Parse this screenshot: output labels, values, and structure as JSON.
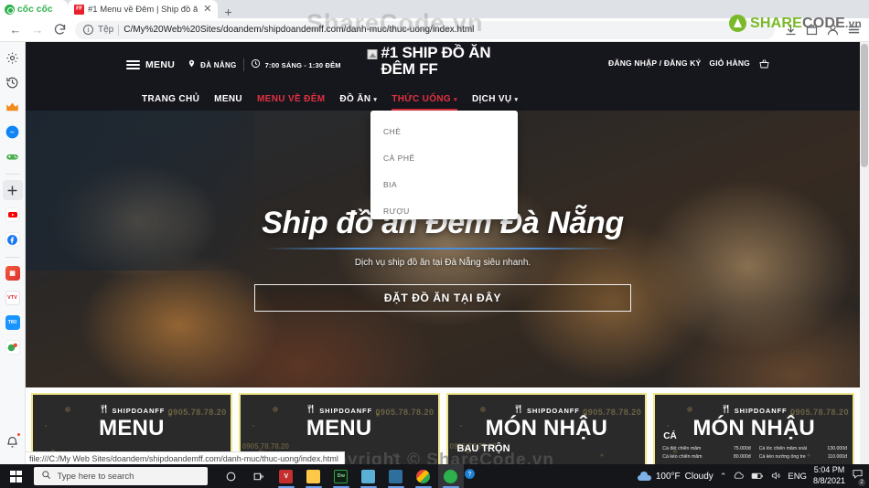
{
  "browser": {
    "brand_tab": "cốc cốc",
    "tab": {
      "title": "#1 Menu về Đêm | Ship đồ ă",
      "favicon_label": "FF",
      "close": "✕",
      "new_tab": "+"
    },
    "toolbar": {
      "back": "←",
      "forward": "→",
      "reload": "C",
      "scheme_label": "Tệp",
      "url": "C/My%20Web%20Sites/doandem/shipdoandemff.com/danh-muc/thuc-uong/index.html"
    },
    "status_url": "file:///C:/My Web Sites/doandem/shipdoandemff.com/danh-muc/thuc-uong/index.html"
  },
  "sidebar": {
    "items": [
      {
        "name": "settings-icon",
        "label": "⚙"
      },
      {
        "name": "history-icon",
        "label": "⟲"
      },
      {
        "name": "crown-icon",
        "label": "♛",
        "color": "#f28a1c"
      },
      {
        "name": "messenger-icon",
        "label": "✈",
        "color": "#1e88e5"
      },
      {
        "name": "gamepad-icon",
        "label": "🎮",
        "color": "#4caf50"
      },
      {
        "name": "add-icon",
        "label": "+"
      },
      {
        "name": "youtube-icon",
        "label": "▶",
        "color": "#ff0000"
      },
      {
        "name": "facebook-icon",
        "label": "f",
        "color": "#1877f2"
      },
      {
        "name": "app-red-icon",
        "label": "▦",
        "color": "#e8453c"
      },
      {
        "name": "vtv-icon",
        "label": "VTV",
        "color": "#ffffff"
      },
      {
        "name": "tiki-icon",
        "label": "TIKI",
        "color": "#1a94ff"
      },
      {
        "name": "green-app-icon",
        "label": "●",
        "color": "#3aa655"
      },
      {
        "name": "notifications-bell-icon",
        "label": "🔔"
      },
      {
        "name": "more-icon",
        "label": "•••"
      }
    ]
  },
  "site": {
    "menu_label": "MENU",
    "location": "ĐÀ NẴNG",
    "hours": "7:00 SÁNG - 1:30 ĐÊM",
    "brand_title": "#1 SHIP ĐỒ ĂN ĐÊM FF",
    "login_label": "ĐĂNG NHẬP / ĐĂNG KÝ",
    "cart_label": "GIỎ HÀNG",
    "nav": [
      {
        "label": "TRANG CHỦ",
        "active": false,
        "caret": false
      },
      {
        "label": "MENU",
        "active": false,
        "caret": false
      },
      {
        "label": "MENU VỀ ĐÊM",
        "active": true,
        "caret": false
      },
      {
        "label": "ĐỒ ĂN",
        "active": false,
        "caret": true
      },
      {
        "label": "THỨC UỐNG",
        "active": true,
        "caret": true
      },
      {
        "label": "DỊCH VỤ",
        "active": false,
        "caret": true
      }
    ],
    "dropdown": {
      "items": [
        "CHÈ",
        "CÀ PHÊ",
        "BIA",
        "RƯỢU"
      ]
    },
    "hero": {
      "title": "Ship đồ ăn Đêm Đà Nẵng",
      "subtitle": "Dịch vụ ship đồ ăn tại Đà Nẵng siêu nhanh.",
      "cta": "ĐẶT ĐỒ ĂN TẠI ĐÂY"
    },
    "cards": [
      {
        "brand": "SHIPDOANFF",
        "title": "MENU",
        "subtitle": "",
        "category": "",
        "phone": "0905.78.78.20"
      },
      {
        "brand": "SHIPDOANFF",
        "title": "MENU",
        "subtitle": "",
        "category": "",
        "phone": "0905.78.78.20"
      },
      {
        "brand": "SHIPDOANFF",
        "title": "MÓN NHẬU",
        "subtitle": "BAU TRỘN",
        "category": "",
        "phone": "0905.78.78.20"
      },
      {
        "brand": "SHIPDOANFF",
        "title": "MÓN NHẬU",
        "subtitle": "",
        "category": "CÁ",
        "phone": "0905.78.78.20",
        "menu_left": [
          {
            "name": "Cá đét chiên mắm",
            "price": "75.000đ"
          },
          {
            "name": "Cá kèo chiên mắm",
            "price": "80.000đ"
          }
        ],
        "menu_right": [
          {
            "name": "Cá lóc chiên mắm xoài",
            "price": "130.000đ"
          },
          {
            "name": "Cá kèo nướng ống tre",
            "price": "110.000đ"
          }
        ]
      }
    ]
  },
  "watermark": {
    "top": "ShareCode.vn",
    "mid": "Copyright © ShareCode.vn",
    "logo_share": "SHARE",
    "logo_code": "CODE",
    "logo_vn": ".vn"
  },
  "taskbar": {
    "search_placeholder": "Type here to search",
    "apps": [
      {
        "name": "cortana-icon",
        "label": "◯",
        "color": "transparent"
      },
      {
        "name": "task-view-icon",
        "label": "▤",
        "color": "transparent"
      },
      {
        "name": "vs-code-icon",
        "label": "V",
        "color": "#c52f2f"
      },
      {
        "name": "file-explorer-icon",
        "label": "▤",
        "color": "#ffc848"
      },
      {
        "name": "dreamweaver-icon",
        "label": "Dw",
        "color": "#35a14b"
      },
      {
        "name": "photoshop-icon",
        "label": "Ps",
        "color": "#5bb0d8"
      },
      {
        "name": "camera-icon",
        "label": "■",
        "color": "#3f8fc4"
      },
      {
        "name": "chrome-icon",
        "label": "◉",
        "color": "#e8453c"
      },
      {
        "name": "coccoc-icon",
        "label": "◎",
        "color": "#2bb24c"
      }
    ],
    "tray": {
      "weather_temp": "100°F",
      "weather_cond": "Cloudy",
      "chevron": "⌃",
      "lang": "ENG",
      "time": "5:04 PM",
      "date": "8/8/2021",
      "notify_count": "2"
    }
  }
}
